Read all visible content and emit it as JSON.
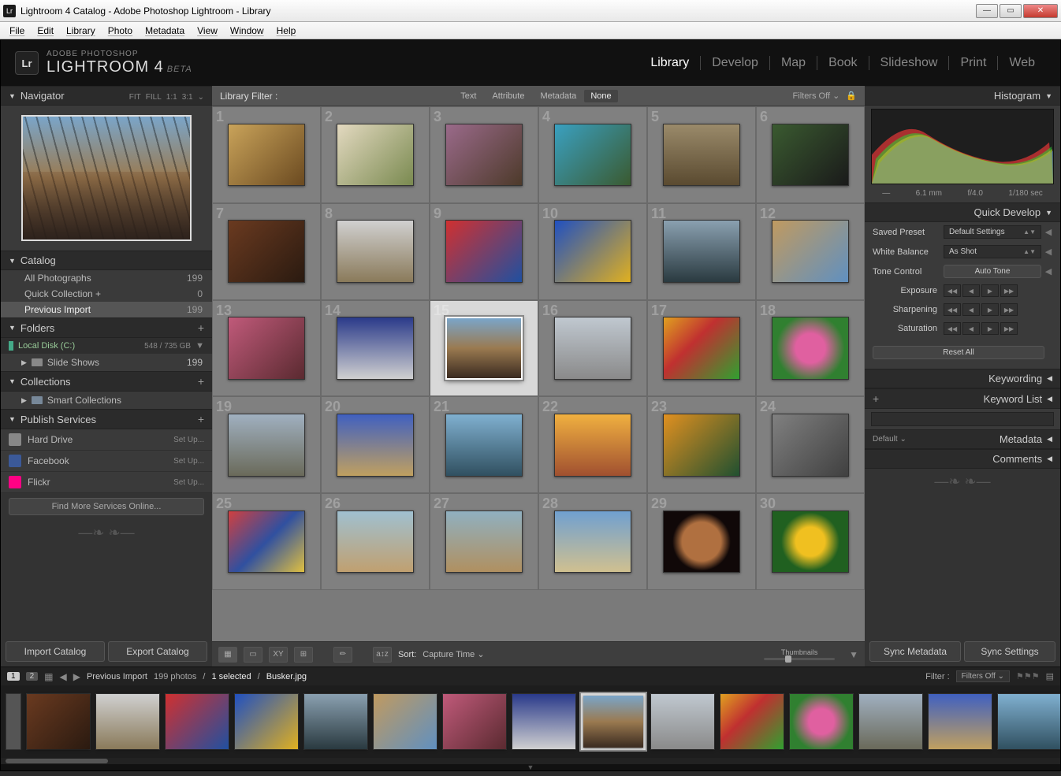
{
  "window": {
    "title": "Lightroom 4 Catalog - Adobe Photoshop Lightroom - Library",
    "app_badge": "Lr"
  },
  "menubar": [
    "File",
    "Edit",
    "Library",
    "Photo",
    "Metadata",
    "View",
    "Window",
    "Help"
  ],
  "branding": {
    "line1": "ADOBE PHOTOSHOP",
    "line2": "LIGHTROOM 4",
    "beta": "BETA"
  },
  "modules": [
    "Library",
    "Develop",
    "Map",
    "Book",
    "Slideshow",
    "Print",
    "Web"
  ],
  "active_module": "Library",
  "navigator": {
    "title": "Navigator",
    "zoom_opts": [
      "FIT",
      "FILL",
      "1:1",
      "3:1"
    ]
  },
  "catalog": {
    "title": "Catalog",
    "rows": [
      {
        "label": "All Photographs",
        "count": "199"
      },
      {
        "label": "Quick Collection  +",
        "count": "0"
      },
      {
        "label": "Previous Import",
        "count": "199",
        "selected": true
      }
    ]
  },
  "folders": {
    "title": "Folders",
    "disk": {
      "name": "Local Disk (C:)",
      "size": "548 / 735 GB"
    },
    "items": [
      {
        "label": "Slide Shows",
        "count": "199"
      }
    ]
  },
  "collections": {
    "title": "Collections",
    "items": [
      {
        "label": "Smart Collections"
      }
    ]
  },
  "publish": {
    "title": "Publish Services",
    "rows": [
      {
        "label": "Hard Drive",
        "color": "#888",
        "setup": "Set Up..."
      },
      {
        "label": "Facebook",
        "color": "#3b5998",
        "setup": "Set Up..."
      },
      {
        "label": "Flickr",
        "color": "#ff0084",
        "setup": "Set Up..."
      }
    ],
    "findmore": "Find More Services Online..."
  },
  "left_buttons": {
    "import": "Import Catalog",
    "export": "Export Catalog"
  },
  "filterbar": {
    "label": "Library Filter :",
    "opts": [
      "Text",
      "Attribute",
      "Metadata",
      "None"
    ],
    "active": "None",
    "filters_off": "Filters Off"
  },
  "grid": {
    "count": 30,
    "selected_index": 14
  },
  "toolbar": {
    "sort_label": "Sort:",
    "sort_value": "Capture Time",
    "thumbs_label": "Thumbnails"
  },
  "right": {
    "histogram": {
      "title": "Histogram",
      "focal": "6.1 mm",
      "aperture": "f/4.0",
      "shutter": "1/180 sec",
      "dash": "—"
    },
    "quickdev": {
      "title": "Quick Develop",
      "preset_label": "Saved Preset",
      "preset_value": "Default Settings",
      "wb_label": "White Balance",
      "wb_value": "As Shot",
      "tone_label": "Tone Control",
      "auto": "Auto Tone",
      "exposure": "Exposure",
      "sharpen": "Sharpening",
      "saturation": "Saturation",
      "reset": "Reset All"
    },
    "keywording": "Keywording",
    "keywordlist": "Keyword List",
    "metadata": {
      "title": "Metadata",
      "preset": "Default"
    },
    "comments": "Comments"
  },
  "right_buttons": {
    "sync_meta": "Sync Metadata",
    "sync_set": "Sync Settings"
  },
  "filmstrip_top": {
    "screen1": "1",
    "screen2": "2",
    "crumb": "Previous Import",
    "photos": "199 photos",
    "selected": "1 selected",
    "file": "Busker.jpg",
    "filter_label": "Filter :",
    "filter_value": "Filters Off"
  },
  "filmstrip_indices": [
    6,
    7,
    8,
    9,
    10,
    11,
    12,
    13,
    14,
    15,
    16,
    17,
    18,
    19,
    20,
    21,
    22
  ]
}
